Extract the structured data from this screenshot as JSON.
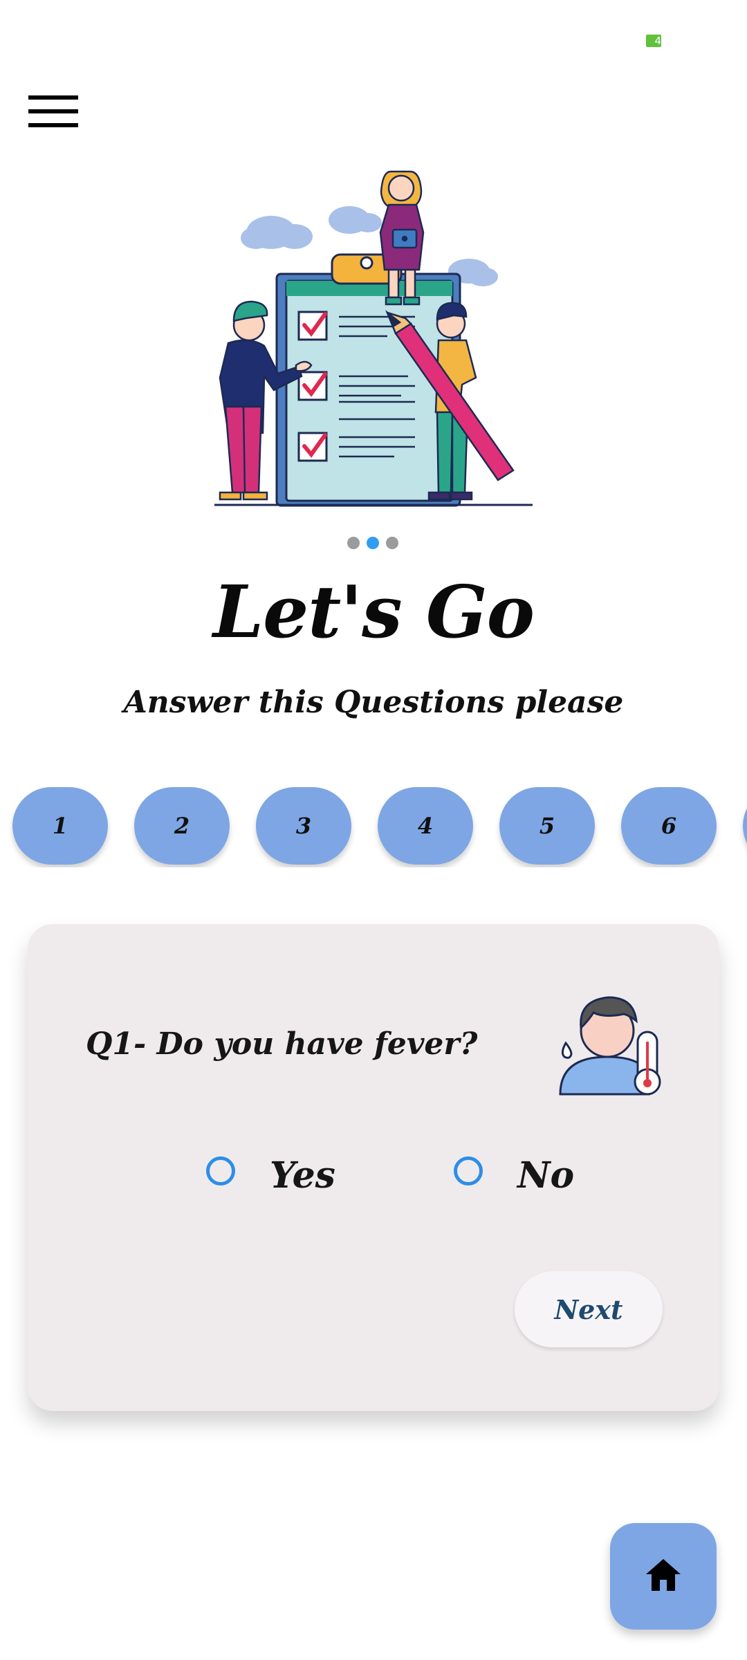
{
  "status_bar": {
    "battery_text": "4",
    "battery_color": "#5fc23a"
  },
  "menu": {
    "icon": "hamburger-menu-icon"
  },
  "illustration": {
    "icon": "questionnaire-checklist-illustration"
  },
  "pager": {
    "total": 3,
    "active_index": 1
  },
  "header": {
    "title": "Let's Go",
    "subtitle": "Answer this Questions please"
  },
  "question_numbers": [
    "1",
    "2",
    "3",
    "4",
    "5",
    "6"
  ],
  "question": {
    "text": "Q1- Do you have fever?",
    "icon": "fever-thermometer-icon",
    "options": [
      {
        "label": "Yes",
        "selected": false
      },
      {
        "label": "No",
        "selected": false
      }
    ],
    "next_label": "Next"
  },
  "home_button": {
    "icon": "home-icon"
  },
  "colors": {
    "accent_blue": "#7ea6e4",
    "radio_blue": "#2c8ee8",
    "card_bg": "#efebed",
    "next_text": "#1e4a6e"
  }
}
